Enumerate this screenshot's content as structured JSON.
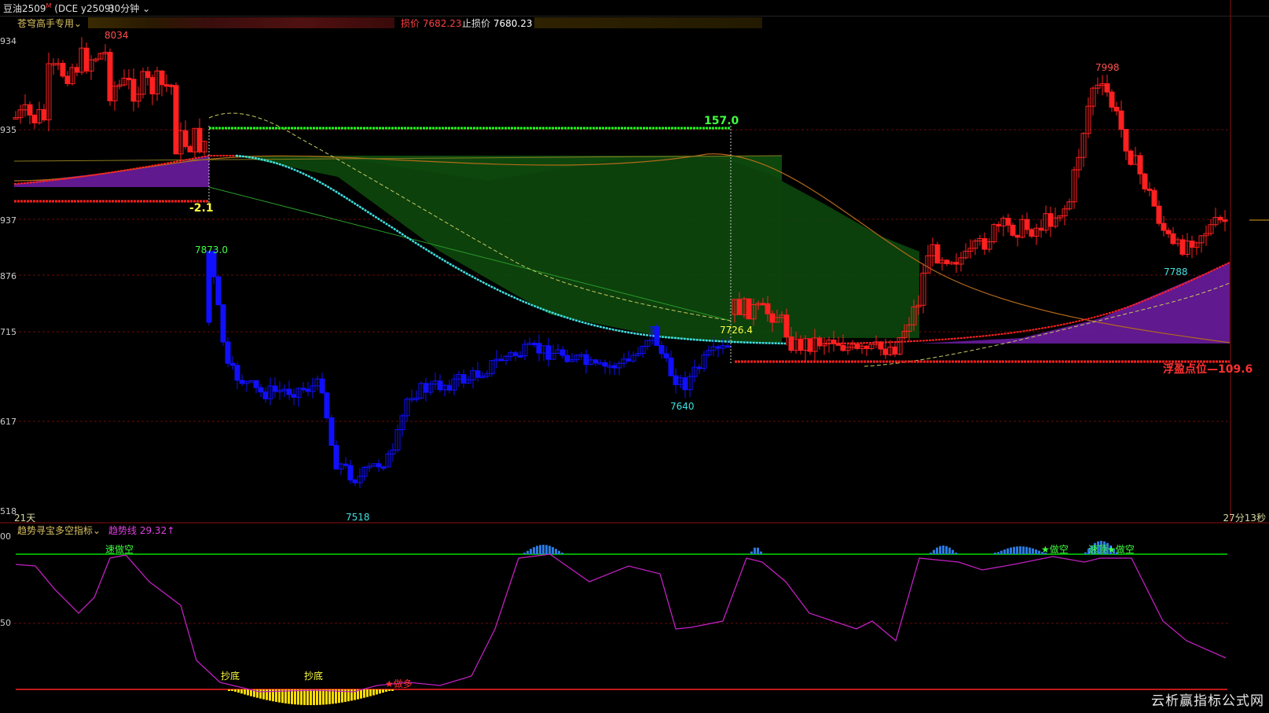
{
  "header": {
    "symbol": "豆油2509",
    "symbol_suffix": "(DCE y2509)",
    "period": "30分钟"
  },
  "indicator_bar": {
    "indicator_name": "苍穹高手专用",
    "stop_loss_label": "损价",
    "stop_loss_value": "7682.23",
    "take_profit_label": "止损价",
    "take_profit_value": "7680.23"
  },
  "y_axis_labels": [
    "934",
    "935",
    "937",
    "876",
    "715",
    "617",
    "518"
  ],
  "price_labels": {
    "high_left": "8034",
    "high_right": "7998",
    "low": "7518",
    "low_mid": "7640",
    "low_right": "7788",
    "blue_high": "7873.0",
    "yellow_level": "7726.4",
    "green_top": "157.0",
    "neg_val": "-2.1",
    "float_point": "浮盈点位—109.6"
  },
  "footer_main": {
    "days": "21天",
    "timer": "27分13秒"
  },
  "sub_chart": {
    "indicator_name": "趋势寻宝多空指标",
    "trend_label": "趋势线",
    "trend_value": "29.32↑",
    "y_labels": [
      "00",
      "50"
    ],
    "signals": {
      "short1": "做空",
      "short1_prefix": "速",
      "short2": "★做空",
      "short3": "★做空",
      "short3_prefix": "速顶",
      "bottom1": "抄底",
      "bottom2": "抄底",
      "long": "★做多"
    },
    "colors": {
      "line": "#c020c0",
      "top_line": "#00dd00",
      "bottom_line": "#ff2020"
    }
  },
  "watermark": "云析赢指标公式网",
  "colors": {
    "up": "#ff2020",
    "down": "#0000ff",
    "green_zone": "#0b3a0b",
    "purple_zone": "#6a1c9e",
    "cyan_curve": "#40e0e0"
  }
}
